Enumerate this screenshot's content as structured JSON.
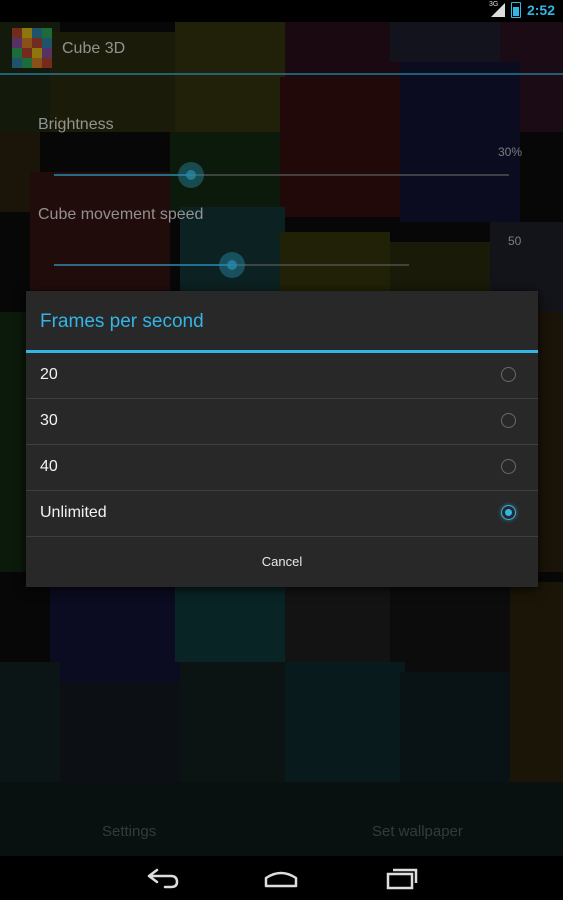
{
  "status_bar": {
    "signal_label": "3G",
    "clock": "2:52",
    "accent_color": "#33b5e5"
  },
  "app": {
    "title": "Cube 3D",
    "icon": "cube-mosaic-icon"
  },
  "preferences": {
    "brightness_label": "Brightness",
    "brightness_value": "30%",
    "brightness_level": 0.3,
    "speed_label": "Cube movement speed",
    "speed_value": "50",
    "speed_level": 0.5
  },
  "dialog": {
    "title": "Frames per second",
    "options": [
      {
        "label": "20",
        "selected": false
      },
      {
        "label": "30",
        "selected": false
      },
      {
        "label": "40",
        "selected": false
      },
      {
        "label": "Unlimited",
        "selected": true
      }
    ],
    "cancel_label": "Cancel"
  },
  "bottom_buttons": {
    "settings_label": "Settings",
    "set_wallpaper_label": "Set wallpaper"
  },
  "nav_bar": {
    "back": "back-icon",
    "home": "home-icon",
    "recents": "recents-icon"
  }
}
